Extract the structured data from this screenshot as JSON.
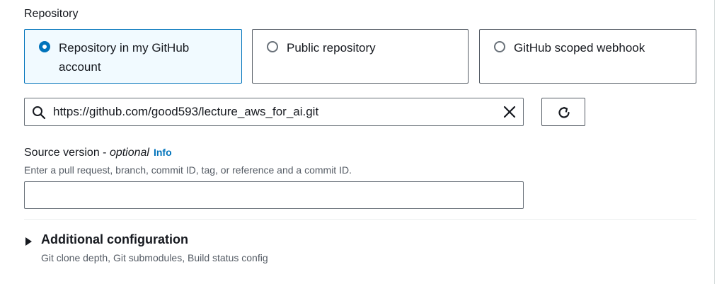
{
  "repository": {
    "label": "Repository",
    "options": [
      {
        "label": "Repository in my GitHub account",
        "selected": true
      },
      {
        "label": "Public repository",
        "selected": false
      },
      {
        "label": "GitHub scoped webhook",
        "selected": false
      }
    ]
  },
  "search": {
    "value": "https://github.com/good593/lecture_aws_for_ai.git",
    "icon": "search-icon",
    "clear_icon": "close-icon"
  },
  "refresh": {
    "icon": "refresh-icon"
  },
  "source_version": {
    "label": "Source version - ",
    "optional": "optional",
    "info": "Info",
    "description": "Enter a pull request, branch, commit ID, tag, or reference and a commit ID.",
    "value": ""
  },
  "additional": {
    "title": "Additional configuration",
    "description": "Git clone depth, Git submodules, Build status config"
  },
  "colors": {
    "accent": "#0073bb",
    "selected_bg": "#f1faff",
    "border": "#545b64"
  }
}
